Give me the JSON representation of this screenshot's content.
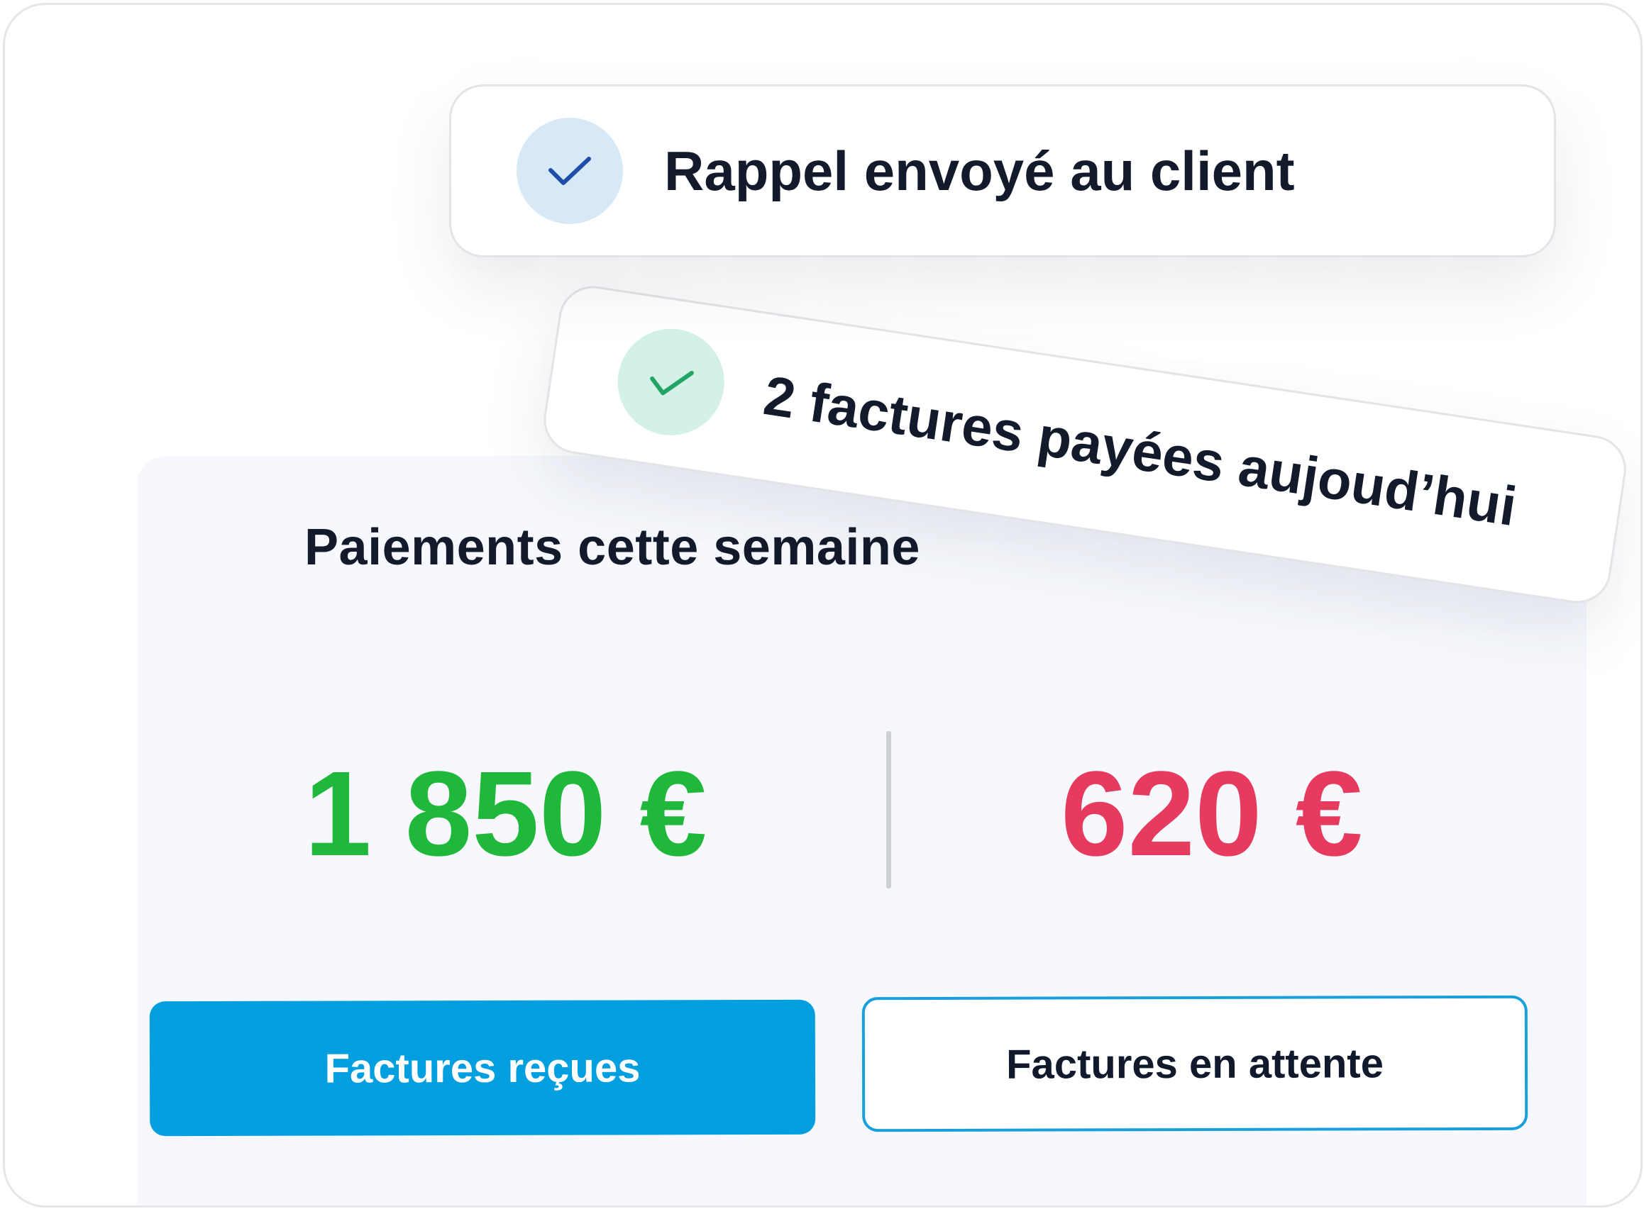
{
  "notifications": [
    {
      "text": "2 factures payées aujoud’hui",
      "icon": "check-icon",
      "icon_color": "#22a464",
      "circle_color": "#d3f1e6"
    },
    {
      "text": "Rappel envoyé au client",
      "icon": "check-icon",
      "icon_color": "#1e4ea8",
      "circle_color": "#d7e9f7"
    }
  ],
  "summary": {
    "title": "Paiements cette semaine",
    "received_amount": "1 850 €",
    "pending_amount": "620 €"
  },
  "buttons": {
    "received_label": "Factures reçues",
    "pending_label": "Factures en attente"
  },
  "colors": {
    "received": "#1fb83a",
    "pending": "#e63b5e",
    "accent": "#019fdf"
  }
}
